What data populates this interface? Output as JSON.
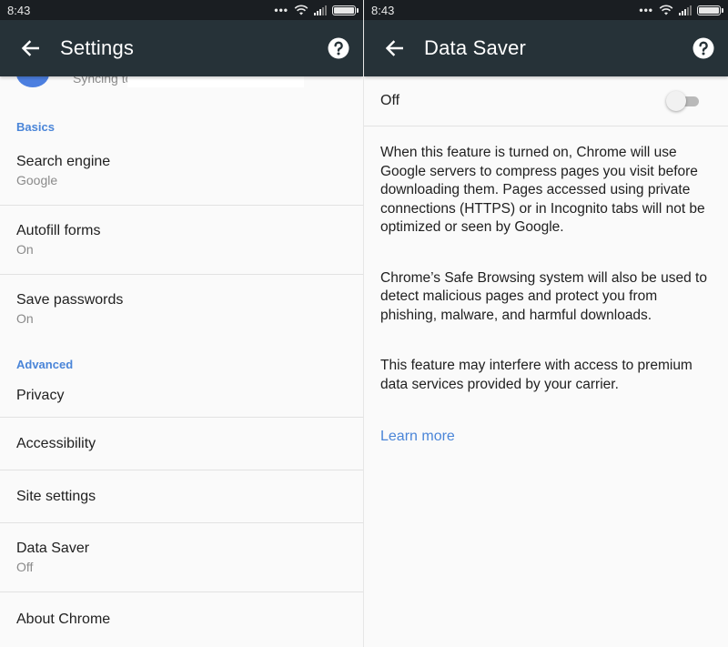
{
  "status_bar": {
    "time": "8:43"
  },
  "settings_screen": {
    "title": "Settings",
    "account": {
      "sync_text": "Syncing to"
    },
    "sections": {
      "basics": "Basics",
      "advanced": "Advanced"
    },
    "items": {
      "search_engine": {
        "label": "Search engine",
        "value": "Google"
      },
      "autofill_forms": {
        "label": "Autofill forms",
        "value": "On"
      },
      "save_passwords": {
        "label": "Save passwords",
        "value": "On"
      },
      "privacy": {
        "label": "Privacy"
      },
      "accessibility": {
        "label": "Accessibility"
      },
      "site_settings": {
        "label": "Site settings"
      },
      "data_saver": {
        "label": "Data Saver",
        "value": "Off"
      },
      "about_chrome": {
        "label": "About Chrome"
      }
    }
  },
  "data_saver_screen": {
    "title": "Data Saver",
    "toggle": {
      "label": "Off",
      "on": false
    },
    "paragraphs": {
      "p1": "When this feature is turned on, Chrome will use Google servers to compress pages you visit before downloading them. Pages accessed using private connections (HTTPS) or in Incognito tabs will not be optimized or seen by Google.",
      "p2": "Chrome’s Safe Browsing system will also be used to detect malicious pages and protect you from phishing, malware, and harmful downloads.",
      "p3": "This feature may interfere with access to premium data services provided by your carrier."
    },
    "learn_more": "Learn more"
  },
  "icons": {
    "back": "arrow-back-icon",
    "help": "help-icon",
    "wifi": "wifi-icon",
    "signal": "signal-icon",
    "battery": "battery-icon"
  },
  "colors": {
    "app_bar": "#263238",
    "status_bar": "#1a1e22",
    "accent": "#4a85d8",
    "background": "#fafafa"
  }
}
